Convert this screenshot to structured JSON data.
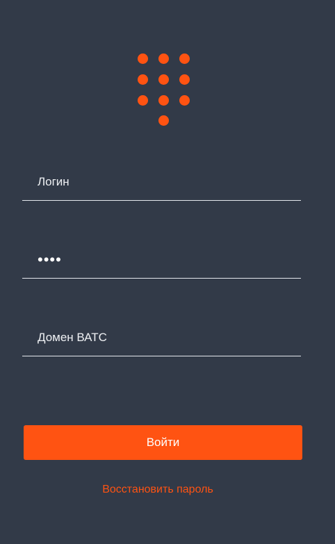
{
  "brand": {
    "logo": "keypad-dots-icon",
    "accent_color": "#ff5312",
    "background_color": "#323a48"
  },
  "form": {
    "login": {
      "placeholder": "Логин",
      "value": ""
    },
    "password": {
      "value": "1234"
    },
    "domain": {
      "placeholder": "Домен ВАТС",
      "value": ""
    },
    "submit_label": "Войти",
    "recover_label": "Восстановить пароль"
  }
}
